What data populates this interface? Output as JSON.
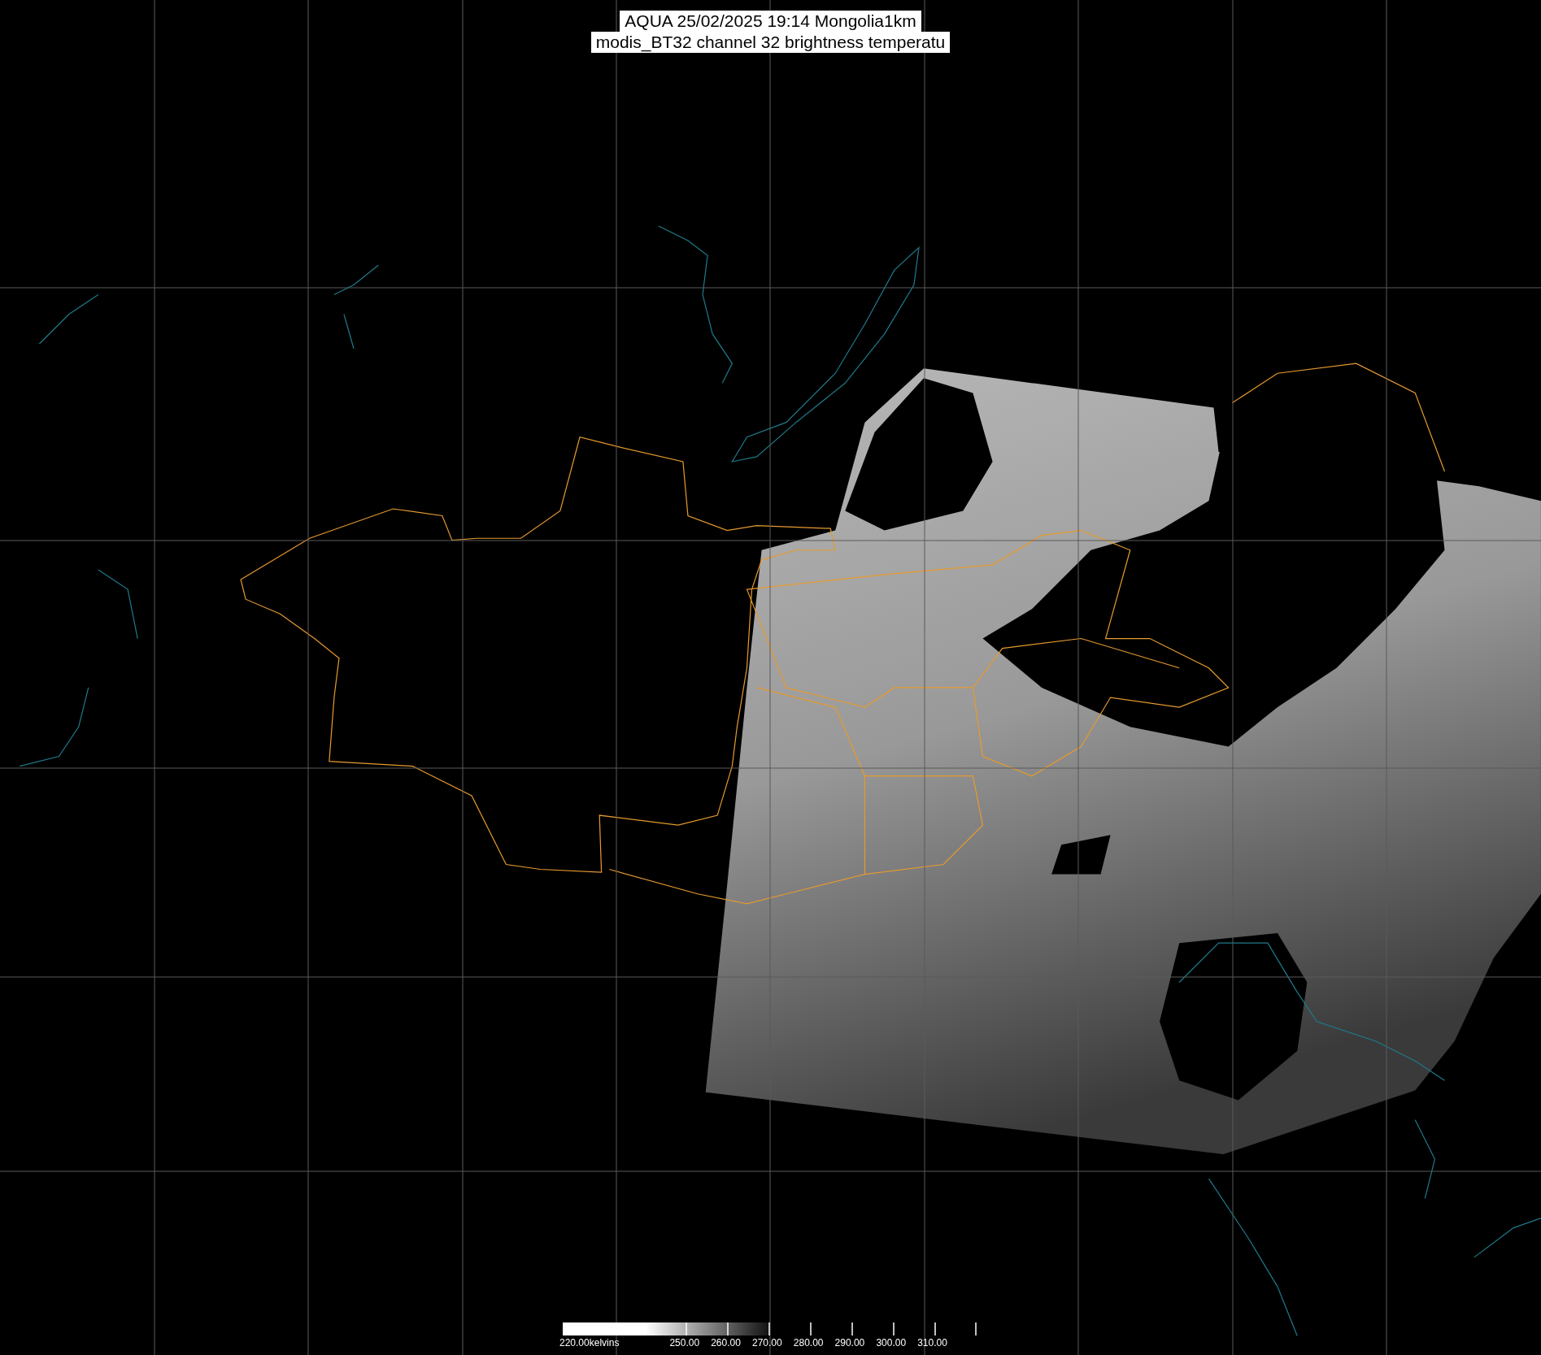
{
  "title": {
    "lines": [
      "AQUA 25/02/2025 19:14 Mongolia1km",
      "modis_BT32 channel 32 brightness temperatu"
    ]
  },
  "colorbar": {
    "labels": [
      "220.00kelvins",
      "250.00",
      "260.00",
      "270.00",
      "280.00",
      "290.00",
      "300.00",
      "310.00"
    ]
  }
}
